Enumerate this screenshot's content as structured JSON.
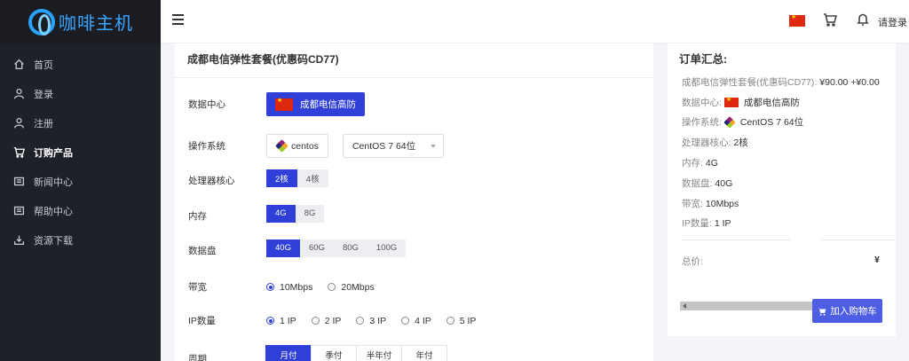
{
  "brand": {
    "name": "咖啡主机",
    "accent": "#2aa1ff"
  },
  "sidebar": {
    "items": [
      {
        "label": "首页",
        "icon": "home-icon"
      },
      {
        "label": "登录",
        "icon": "user-icon"
      },
      {
        "label": "注册",
        "icon": "user-icon"
      },
      {
        "label": "订购产品",
        "icon": "cart-icon",
        "active": true
      },
      {
        "label": "新闻中心",
        "icon": "news-icon"
      },
      {
        "label": "帮助中心",
        "icon": "help-icon"
      },
      {
        "label": "资源下载",
        "icon": "download-icon"
      }
    ]
  },
  "topbar": {
    "login_label": "请登录"
  },
  "product": {
    "title": "成都电信弹性套餐(优惠码CD77)",
    "datacenter": {
      "label": "数据中心",
      "value": "成都电信高防"
    },
    "os": {
      "label": "操作系统",
      "family": "centos",
      "version": "CentOS 7 64位"
    },
    "cpu": {
      "label": "处理器核心",
      "options": [
        "2核",
        "4核"
      ],
      "selected": "2核"
    },
    "memory": {
      "label": "内存",
      "options": [
        "4G",
        "8G"
      ],
      "selected": "4G"
    },
    "disk": {
      "label": "数据盘",
      "options": [
        "40G",
        "60G",
        "80G",
        "100G"
      ],
      "selected": "40G"
    },
    "bandwidth": {
      "label": "带宽",
      "options": [
        "10Mbps",
        "20Mbps"
      ],
      "selected": "10Mbps"
    },
    "ip": {
      "label": "IP数量",
      "options": [
        "1 IP",
        "2 IP",
        "3 IP",
        "4 IP",
        "5 IP"
      ],
      "selected": "1 IP"
    },
    "period": {
      "label": "周期",
      "options": [
        "月付",
        "季付",
        "半年付",
        "年付"
      ],
      "selected": "月付"
    }
  },
  "summary": {
    "title": "订单汇总:",
    "product_line_label": "成都电信弹性套餐(优惠码CD77):",
    "product_line_value": "¥90.00 +¥0.00",
    "datacenter_label": "数据中心:",
    "datacenter_value": "成都电信高防",
    "os_label": "操作系统:",
    "os_value": "CentOS 7 64位",
    "cpu_label": "处理器核心:",
    "cpu_value": "2核",
    "memory_label": "内存:",
    "memory_value": "4G",
    "disk_label": "数据盘:",
    "disk_value": "40G",
    "bandwidth_label": "带宽:",
    "bandwidth_value": "10Mbps",
    "ip_label": "IP数量:",
    "ip_value": "1 IP",
    "total_label": "总价:",
    "total_value": "¥",
    "add_to_cart": "加入购物车"
  }
}
